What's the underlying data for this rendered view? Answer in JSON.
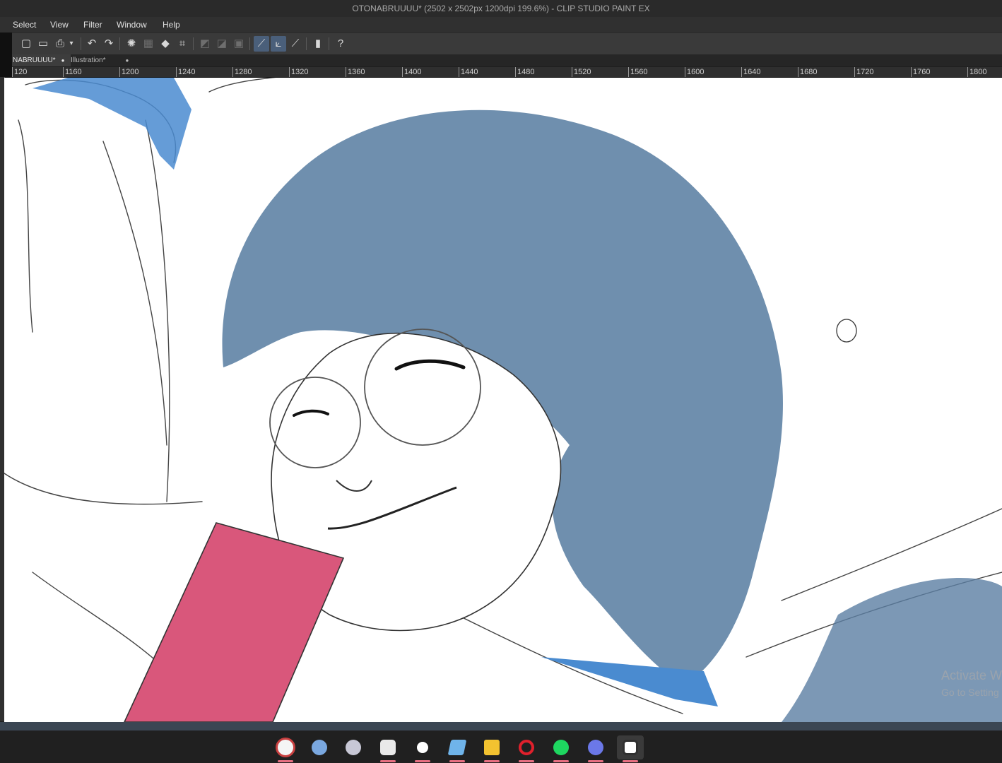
{
  "window": {
    "title": "OTONABRUUUU* (2502 x 2502px 1200dpi 199.6%)  - CLIP STUDIO PAINT EX"
  },
  "menu": {
    "items": [
      "Select",
      "View",
      "Filter",
      "Window",
      "Help"
    ]
  },
  "tabs": [
    {
      "label": "NABRUUUU*",
      "marker": "●"
    },
    {
      "label": "Illustration*",
      "marker": "●"
    }
  ],
  "ruler": {
    "labels": [
      "120",
      "1160",
      "1200",
      "1240",
      "1280",
      "1320",
      "1360",
      "1400",
      "1440",
      "1480",
      "1520",
      "1560",
      "1600",
      "1640",
      "1680",
      "1720",
      "1760",
      "1800"
    ]
  },
  "toolbar": {
    "icons": [
      "new-icon",
      "open-icon",
      "save-icon",
      "undo-icon",
      "redo-icon",
      "select-all-icon",
      "clear-icon",
      "fill-icon",
      "transform-icon",
      "ruler-snap-icon",
      "special-ruler-icon",
      "perspective-icon",
      "pen-stabilize-icon",
      "color-wheel-icon",
      "help-icon"
    ]
  },
  "watermark": {
    "line1": "Activate W",
    "line2": "Go to Setting"
  },
  "taskbar": {
    "apps": [
      "clip-studio-paint-icon",
      "krita-icon",
      "app-icon",
      "clip-studio-icon",
      "steam-icon",
      "app-window-icon",
      "file-explorer-icon",
      "opera-icon",
      "spotify-icon",
      "discord-icon",
      "clip-studio-paint-active-icon"
    ]
  },
  "colors": {
    "hair": "#6f8fae",
    "collar": "#d9577b",
    "scarf": "#4a8bd0",
    "active_tool": "#4a5f7a"
  }
}
